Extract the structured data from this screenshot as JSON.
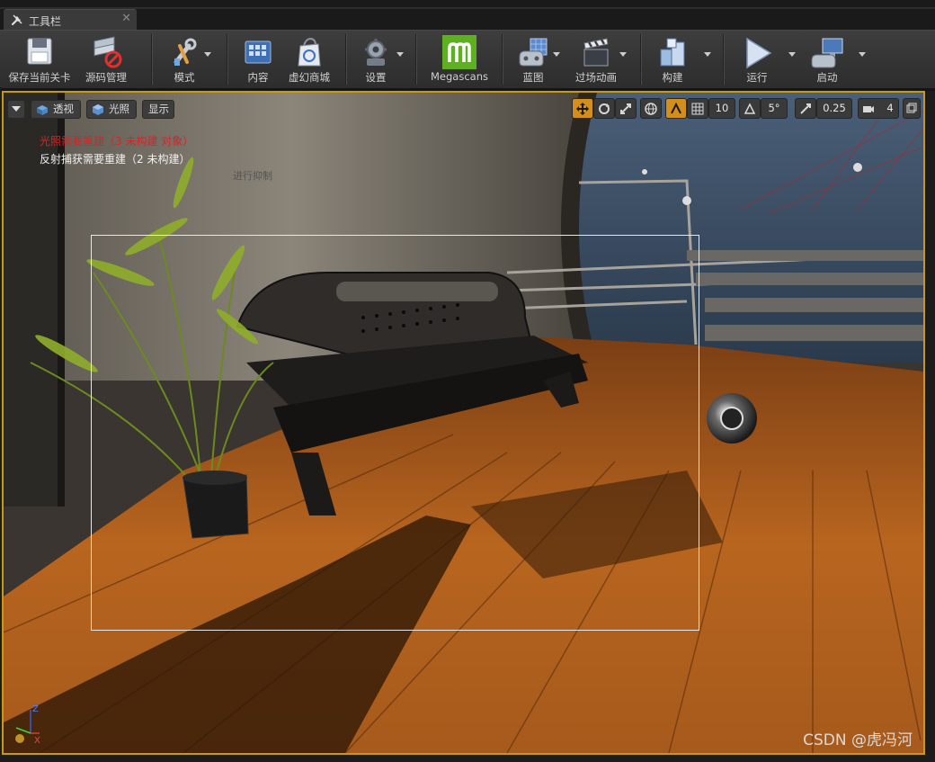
{
  "tab": {
    "title": "工具栏",
    "icon": "wrench-icon",
    "close": "✕"
  },
  "toolbar": {
    "items": [
      {
        "label": "保存当前关卡",
        "icon": "save-floppy-icon"
      },
      {
        "label": "源码管理",
        "icon": "source-control-icon"
      },
      {
        "label": "模式",
        "icon": "modes-icon"
      },
      {
        "label": "内容",
        "icon": "content-browser-icon"
      },
      {
        "label": "虚幻商城",
        "icon": "marketplace-icon"
      },
      {
        "label": "设置",
        "icon": "settings-icon"
      },
      {
        "label": "Megascans",
        "icon": "megascans-icon"
      },
      {
        "label": "蓝图",
        "icon": "blueprint-icon"
      },
      {
        "label": "过场动画",
        "icon": "cinematics-icon"
      },
      {
        "label": "构建",
        "icon": "build-icon"
      },
      {
        "label": "运行",
        "icon": "play-icon"
      },
      {
        "label": "启动",
        "icon": "launch-icon"
      }
    ]
  },
  "viewport": {
    "options_menu": "viewport-options-icon",
    "perspective_label": "透视",
    "lit_label": "光照",
    "show_label": "显示",
    "grid_snap_value": "10",
    "rotation_snap_value": "5°",
    "scale_snap_value": "0.25",
    "camera_speed_value": "4",
    "warning_lighting": "光照需要重建（3 未构建 对象）",
    "warning_reflection": "反射捕获需要重建（2 未构建）",
    "faded_text": "进行抑制",
    "axis_z": "Z",
    "axis_x": "X"
  },
  "watermark": "CSDN @虎冯河",
  "colors": {
    "accent": "#c79a14",
    "warning": "#e02020",
    "snap_active": "#d38e1c",
    "megascans_green": "#5fb021"
  }
}
